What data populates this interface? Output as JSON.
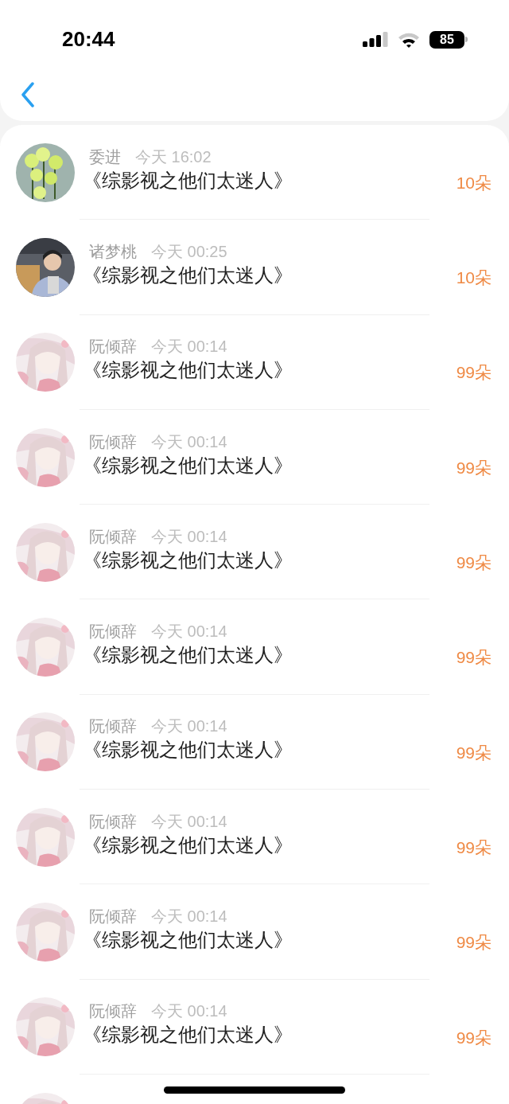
{
  "status_bar": {
    "time": "20:44",
    "battery": "85"
  },
  "rows": [
    {
      "avatar": {
        "kind": "picture"
      },
      "name": "委进",
      "time": "今天 16:02",
      "title": "《综影视之他们太迷人》",
      "amount": "10朵"
    },
    {
      "avatar": {
        "kind": "picture"
      },
      "name": "诸梦桃",
      "time": "今天 00:25",
      "title": "《综影视之他们太迷人》",
      "amount": "10朵"
    },
    {
      "avatar": {
        "kind": "picture"
      },
      "name": "阮倾辞",
      "time": "今天 00:14",
      "title": "《综影视之他们太迷人》",
      "amount": "99朵"
    },
    {
      "avatar": {
        "kind": "picture"
      },
      "name": "阮倾辞",
      "time": "今天 00:14",
      "title": "《综影视之他们太迷人》",
      "amount": "99朵"
    },
    {
      "avatar": {
        "kind": "picture"
      },
      "name": "阮倾辞",
      "time": "今天 00:14",
      "title": "《综影视之他们太迷人》",
      "amount": "99朵"
    },
    {
      "avatar": {
        "kind": "picture"
      },
      "name": "阮倾辞",
      "time": "今天 00:14",
      "title": "《综影视之他们太迷人》",
      "amount": "99朵"
    },
    {
      "avatar": {
        "kind": "picture"
      },
      "name": "阮倾辞",
      "time": "今天 00:14",
      "title": "《综影视之他们太迷人》",
      "amount": "99朵"
    },
    {
      "avatar": {
        "kind": "picture"
      },
      "name": "阮倾辞",
      "time": "今天 00:14",
      "title": "《综影视之他们太迷人》",
      "amount": "99朵"
    },
    {
      "avatar": {
        "kind": "picture"
      },
      "name": "阮倾辞",
      "time": "今天 00:14",
      "title": "《综影视之他们太迷人》",
      "amount": "99朵"
    },
    {
      "avatar": {
        "kind": "picture"
      },
      "name": "阮倾辞",
      "time": "今天 00:14",
      "title": "《综影视之他们太迷人》",
      "amount": "99朵"
    },
    {
      "avatar": {
        "kind": "picture"
      }
    }
  ]
}
